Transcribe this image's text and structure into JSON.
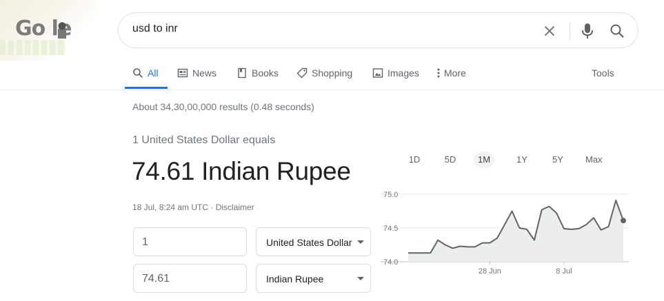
{
  "logo": {
    "text": "Go  le"
  },
  "search": {
    "query": "usd to inr"
  },
  "tabs": [
    {
      "label": "All",
      "icon": "search-icon",
      "active": true
    },
    {
      "label": "News",
      "icon": "newspaper-icon"
    },
    {
      "label": "Books",
      "icon": "book-icon"
    },
    {
      "label": "Shopping",
      "icon": "tag-icon"
    },
    {
      "label": "Images",
      "icon": "image-icon"
    },
    {
      "label": "More",
      "icon": "kebab-icon"
    }
  ],
  "tools_label": "Tools",
  "result_stats": "About 34,30,00,000 results (0.48 seconds)",
  "converter": {
    "equals_label": "1 United States Dollar equals",
    "converted_value": "74.61 Indian Rupee",
    "timestamp": "18 Jul, 8:24 am UTC · Disclaimer",
    "from_amount": "1",
    "from_currency": "United States Dollar",
    "to_amount": "74.61",
    "to_currency": "Indian Rupee"
  },
  "ranges": [
    {
      "label": "1D"
    },
    {
      "label": "5D"
    },
    {
      "label": "1M",
      "active": true
    },
    {
      "label": "1Y"
    },
    {
      "label": "5Y"
    },
    {
      "label": "Max"
    }
  ],
  "colors": {
    "accent": "#1a73e8",
    "chart_line": "#5f6368",
    "chart_fill": "#e6eae7"
  },
  "chart_data": {
    "type": "area",
    "x": [
      "17 Jun",
      "18 Jun",
      "19 Jun",
      "20 Jun",
      "21 Jun",
      "22 Jun",
      "23 Jun",
      "24 Jun",
      "25 Jun",
      "26 Jun",
      "27 Jun",
      "28 Jun",
      "29 Jun",
      "30 Jun",
      "1 Jul",
      "2 Jul",
      "3 Jul",
      "4 Jul",
      "5 Jul",
      "6 Jul",
      "7 Jul",
      "8 Jul",
      "9 Jul",
      "10 Jul",
      "11 Jul",
      "12 Jul",
      "13 Jul",
      "14 Jul",
      "15 Jul",
      "16 Jul",
      "17 Jul",
      "18 Jul"
    ],
    "values": [
      74.13,
      74.13,
      74.13,
      74.13,
      74.32,
      74.25,
      74.2,
      74.23,
      74.22,
      74.22,
      74.28,
      74.28,
      74.35,
      74.55,
      74.75,
      74.5,
      74.48,
      74.32,
      74.77,
      74.82,
      74.72,
      74.49,
      74.48,
      74.49,
      74.55,
      74.65,
      74.47,
      74.52,
      74.91,
      74.61
    ],
    "xticks": [
      "28 Jun",
      "8 Jul"
    ],
    "yticks": [
      "75.0",
      "74.5",
      "74.0"
    ],
    "ylim": [
      74.0,
      75.0
    ],
    "grid": true
  }
}
